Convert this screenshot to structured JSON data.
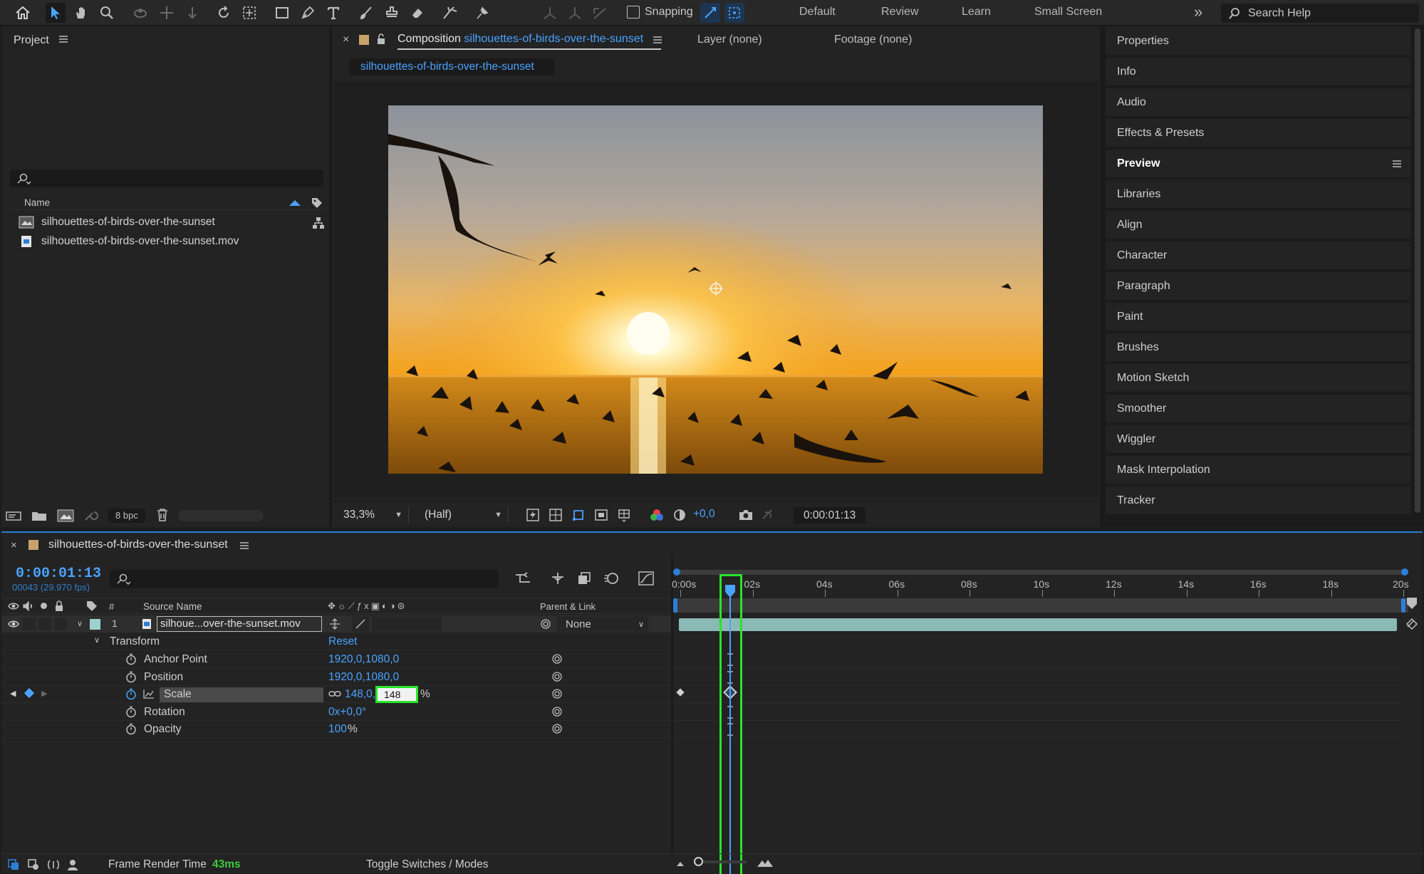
{
  "toolbar": {
    "snapping_label": "Snapping",
    "workspaces": [
      "Default",
      "Review",
      "Learn",
      "Small Screen"
    ],
    "more_label": "»",
    "search_placeholder": "Search Help"
  },
  "project": {
    "title": "Project",
    "column_name": "Name",
    "items": [
      {
        "name": "silhouettes-of-birds-over-the-sunset",
        "type": "composition"
      },
      {
        "name": "silhouettes-of-birds-over-the-sunset.mov",
        "type": "footage"
      }
    ],
    "bpc_label": "8 bpc"
  },
  "composition": {
    "tab_prefix": "Composition",
    "tab_name": "silhouettes-of-birds-over-the-sunset",
    "layer_tab": "Layer (none)",
    "footage_tab": "Footage (none)",
    "breadcrumb": "silhouettes-of-birds-over-the-sunset",
    "zoom": "33,3%",
    "resolution": "(Half)",
    "exposure": "+0,0",
    "timecode": "0:00:01:13"
  },
  "right_panel": {
    "items": [
      "Properties",
      "Info",
      "Audio",
      "Effects & Presets",
      "Preview",
      "Libraries",
      "Align",
      "Character",
      "Paragraph",
      "Paint",
      "Brushes",
      "Motion Sketch",
      "Smoother",
      "Wiggler",
      "Mask Interpolation",
      "Tracker"
    ],
    "active": "Preview"
  },
  "timeline": {
    "comp_name": "silhouettes-of-birds-over-the-sunset",
    "current_time": "0:00:01:13",
    "frame_info": "00043 (29.970 fps)",
    "col_hash": "#",
    "col_source": "Source Name",
    "col_parent": "Parent & Link",
    "layer_number": "1",
    "layer_name": "silhoue...over-the-sunset.mov",
    "parent_value": "None",
    "transform_label": "Transform",
    "reset_label": "Reset",
    "properties": [
      {
        "name": "Anchor Point",
        "value": "1920,0,1080,0"
      },
      {
        "name": "Position",
        "value": "1920,0,1080,0"
      },
      {
        "name": "Scale",
        "value_a": "148,0,",
        "value_b": "148",
        "unit": "%"
      },
      {
        "name": "Rotation",
        "value": "0x+0,0°"
      },
      {
        "name": "Opacity",
        "value": "100",
        "unit": "%"
      }
    ],
    "ruler_labels": [
      "0:00s",
      "02s",
      "04s",
      "06s",
      "08s",
      "10s",
      "12s",
      "14s",
      "16s",
      "18s",
      "20s"
    ],
    "frame_render_label": "Frame Render Time",
    "frame_render_value": "43ms",
    "toggle_label": "Toggle Switches / Modes"
  },
  "colors": {
    "accent_blue": "#2b7fd8",
    "highlight_green": "#28e528",
    "layer_bar": "#8bb9b5",
    "panel_bg": "#232323"
  }
}
